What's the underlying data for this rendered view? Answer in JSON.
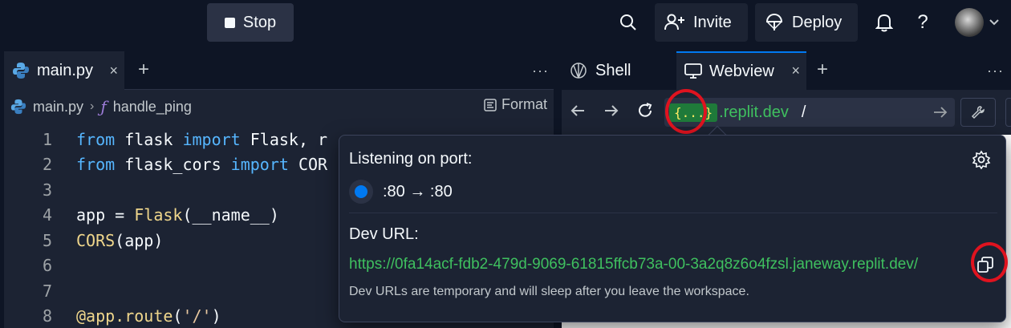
{
  "topbar": {
    "stop_label": "Stop",
    "invite_label": "Invite",
    "deploy_label": "Deploy",
    "help_label": "?"
  },
  "editor": {
    "tab_label": "main.py",
    "tab_close": "×",
    "plus": "+",
    "more": "···",
    "breadcrumb_file": "main.py",
    "breadcrumb_sep": "›",
    "breadcrumb_fn_icon": "ƒ",
    "breadcrumb_fn": "handle_ping",
    "format_label": "Format",
    "lines": [
      {
        "num": "1",
        "tokens": [
          {
            "t": "from",
            "c": "kw"
          },
          {
            "t": " flask ",
            "c": "plain"
          },
          {
            "t": "import",
            "c": "kw"
          },
          {
            "t": " Flask, r",
            "c": "plain"
          }
        ]
      },
      {
        "num": "2",
        "tokens": [
          {
            "t": "from",
            "c": "kw"
          },
          {
            "t": " flask_cors ",
            "c": "plain"
          },
          {
            "t": "import",
            "c": "kw"
          },
          {
            "t": " COR",
            "c": "plain"
          }
        ]
      },
      {
        "num": "3",
        "tokens": []
      },
      {
        "num": "4",
        "tokens": [
          {
            "t": "app = ",
            "c": "plain"
          },
          {
            "t": "Flask",
            "c": "fnc"
          },
          {
            "t": "(__name__)",
            "c": "plain"
          }
        ]
      },
      {
        "num": "5",
        "tokens": [
          {
            "t": "CORS",
            "c": "fnc"
          },
          {
            "t": "(app)",
            "c": "plain"
          }
        ]
      },
      {
        "num": "6",
        "tokens": []
      },
      {
        "num": "7",
        "tokens": []
      },
      {
        "num": "8",
        "tokens": [
          {
            "t": "@app.route",
            "c": "dec"
          },
          {
            "t": "(",
            "c": "plain"
          },
          {
            "t": "'/'",
            "c": "str"
          },
          {
            "t": ")",
            "c": "plain"
          }
        ]
      }
    ]
  },
  "right_panel": {
    "shell_tab": "Shell",
    "webview_tab": "Webview",
    "tab_close": "×",
    "plus": "+",
    "more": "···",
    "url_pill": "{...}",
    "url_domain": ".replit.dev",
    "url_path": "/"
  },
  "popover": {
    "title": "Listening on port:",
    "port_mapping": ":80 → :80",
    "dev_url_label": "Dev URL:",
    "dev_url": "https://0fa14acf-fdb2-479d-9069-61815ffcb73a-00-3a2q8z6o4fzsl.janeway.replit.dev/",
    "note": "Dev URLs are temporary and will sleep after you leave the workspace."
  },
  "colors": {
    "bg": "#0e1525",
    "panel": "#1c2333",
    "accent": "#0079f2",
    "url_green": "#3fc05f",
    "annotation_red": "#e0131f"
  }
}
